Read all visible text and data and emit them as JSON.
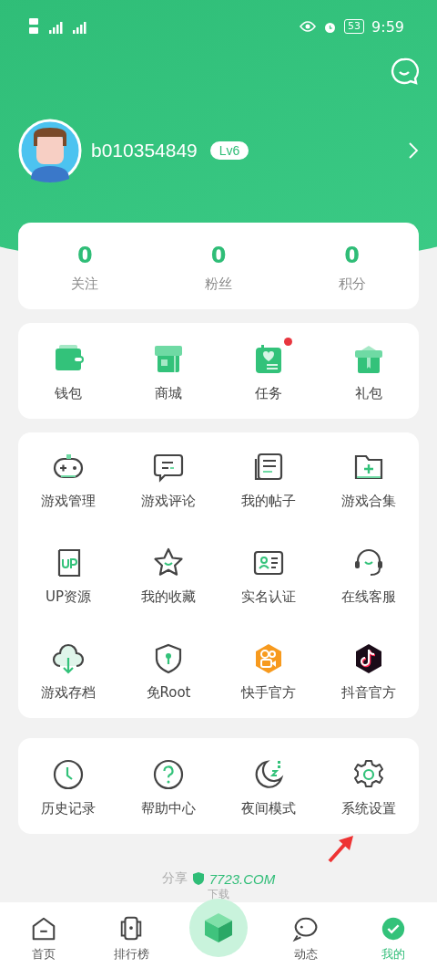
{
  "status_bar": {
    "time": "9:59",
    "battery": "53"
  },
  "profile": {
    "username": "b010354849",
    "level_badge": "Lv6"
  },
  "stats": [
    {
      "value": "0",
      "label": "关注"
    },
    {
      "value": "0",
      "label": "粉丝"
    },
    {
      "value": "0",
      "label": "积分"
    }
  ],
  "quick_actions": [
    {
      "label": "钱包",
      "badge": false
    },
    {
      "label": "商城",
      "badge": false
    },
    {
      "label": "任务",
      "badge": true
    },
    {
      "label": "礼包",
      "badge": false
    }
  ],
  "features": [
    {
      "label": "游戏管理"
    },
    {
      "label": "游戏评论"
    },
    {
      "label": "我的帖子"
    },
    {
      "label": "游戏合集"
    },
    {
      "label": "UP资源"
    },
    {
      "label": "我的收藏"
    },
    {
      "label": "实名认证"
    },
    {
      "label": "在线客服"
    },
    {
      "label": "游戏存档"
    },
    {
      "label": "免Root"
    },
    {
      "label": "快手官方"
    },
    {
      "label": "抖音官方"
    }
  ],
  "tools": [
    {
      "label": "历史记录"
    },
    {
      "label": "帮助中心"
    },
    {
      "label": "夜间模式"
    },
    {
      "label": "系统设置",
      "annotated": true
    }
  ],
  "footer": {
    "share_label": "分享",
    "site": "7723.COM",
    "subtitle": "下载"
  },
  "tab_bar": [
    {
      "label": "首页",
      "selected": false
    },
    {
      "label": "排行榜",
      "selected": false
    },
    {
      "kind": "center"
    },
    {
      "label": "动态",
      "selected": false
    },
    {
      "label": "我的",
      "selected": true
    }
  ]
}
